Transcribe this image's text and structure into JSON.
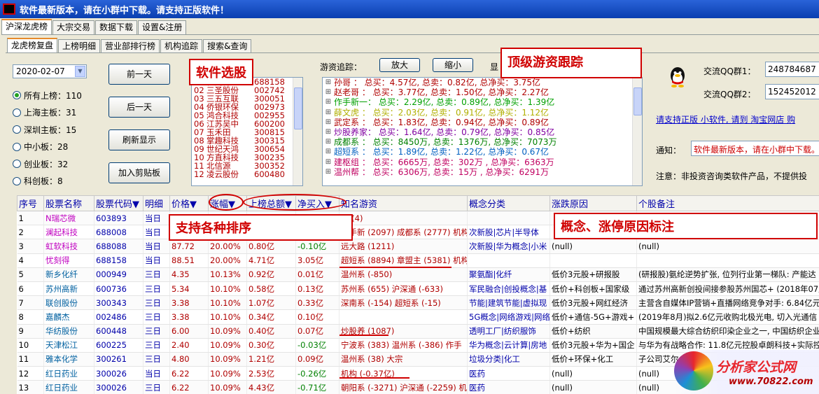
{
  "window": {
    "title": "软件最新版本，请在小群中下载。请支持正版软件！"
  },
  "top_tabs": [
    "沪深龙虎榜",
    "大宗交易",
    "数据下载",
    "设置&注册"
  ],
  "sub_tabs": [
    "龙虎榜复盘",
    "上榜明细",
    "营业部排行榜",
    "机构追踪",
    "搜索&查询"
  ],
  "controls": {
    "date": "2020-02-07",
    "radios": [
      "所有上榜：110",
      "上海主板：31",
      "深圳主板：15",
      "中小板：28",
      "创业板：32",
      "科创板：8"
    ],
    "selected_radio": 0,
    "buttons": [
      "前一天",
      "后一天",
      "刷新显示",
      "加入剪贴板"
    ]
  },
  "stock_picker": {
    "items": [
      {
        "no": "01",
        "name": "忧刻得",
        "code": "688158"
      },
      {
        "no": "02",
        "name": "三圣股份",
        "code": "002742"
      },
      {
        "no": "03",
        "name": "三五互联",
        "code": "300051"
      },
      {
        "no": "04",
        "name": "侨银环保",
        "code": "002973"
      },
      {
        "no": "05",
        "name": "鸿合科技",
        "code": "002955"
      },
      {
        "no": "06",
        "name": "江苏吴中",
        "code": "600200"
      },
      {
        "no": "07",
        "name": "玉禾田",
        "code": "300815"
      },
      {
        "no": "08",
        "name": "掌趣科技",
        "code": "300315"
      },
      {
        "no": "09",
        "name": "世纪天鸿",
        "code": "300654"
      },
      {
        "no": "10",
        "name": "方直科技",
        "code": "300235"
      },
      {
        "no": "11",
        "name": "北信源",
        "code": "300352"
      },
      {
        "no": "12",
        "name": "凌云股份",
        "code": "600480"
      }
    ]
  },
  "track": {
    "label": "游资追踪：",
    "zoom_in": "放大",
    "zoom_out": "缩小",
    "display_label": "显",
    "rows": [
      {
        "text": "孙哥    ： 总买：4.57亿, 总卖：0.82亿, 总净买：3.75亿",
        "color": "#b00000"
      },
      {
        "text": "赵老哥  ： 总买：3.77亿, 总卖：1.50亿, 总净买：2.27亿",
        "color": "#b00000"
      },
      {
        "text": "作手新一： 总买：2.29亿, 总卖：0.89亿, 总净买：1.39亿",
        "color": "#00a000"
      },
      {
        "text": "薛文虎  ： 总买：2.03亿, 总卖：0.91亿, 总净买：1.12亿",
        "color": "#b0b000"
      },
      {
        "text": "武定系  ： 总买：1.83亿, 总卖：0.94亿, 总净买：0.89亿",
        "color": "#b00000"
      },
      {
        "text": "炒股养家： 总买：1.64亿, 总卖：0.79亿, 总净买：0.85亿",
        "color": "#8000a0"
      },
      {
        "text": "成都系  ： 总买：8450万, 总卖：1376万, 总净买：7073万",
        "color": "#008000"
      },
      {
        "text": "超短系  ： 总买：1.89亿, 总卖：1.22亿, 总净买：0.67亿",
        "color": "#0060c0"
      },
      {
        "text": "建枢组  ： 总买：6665万, 总卖：302万 , 总净买：6363万",
        "color": "#c00060"
      },
      {
        "text": "温州帮  ： 总买：6306万, 总卖：15万  , 总净买：6291万",
        "color": "#c00060"
      }
    ]
  },
  "right_panel": {
    "qq1_label": "交流QQ群1：",
    "qq1": "248784687",
    "qq2_label": "交流QQ群2：",
    "qq2": "152452012",
    "link": "请支持正版 小软件, 请到 淘宝网店 购",
    "notice_label": "通知：",
    "notice": "软件最新版本，请在小群中下载。",
    "note": "注意：非投资咨询类软件产品，不提供投"
  },
  "callouts": {
    "picker": "软件选股",
    "track": "顶级游资跟踪",
    "sort": "支持各种排序",
    "concept": "概念、涨停原因标注"
  },
  "table": {
    "headers": [
      "序号",
      "股票名称",
      "股票代码▼",
      "明细",
      "价格▼",
      "涨幅▼",
      "上榜总额▼",
      "净买入▼",
      "知名游资",
      "概念分类",
      "涨跌原因",
      "个股备注"
    ],
    "rows": [
      [
        "1",
        "N瑞芯微",
        "603893",
        "当日",
        "",
        "",
        "",
        "",
        "海 (4)",
        "",
        "",
        ""
      ],
      [
        "2",
        "澜起科技",
        "688008",
        "当日",
        "",
        "",
        "",
        "",
        "通手新 (2097)  成都系 (2777)  机构",
        "次新股|芯片|半导体",
        "",
        ""
      ],
      [
        "3",
        "虹软科技",
        "688088",
        "当日",
        "87.72",
        "20.00%",
        "0.80亿",
        "-0.10亿",
        "远大路 (1211)",
        "次新股|华为概念|小米",
        "(null)",
        "(null)"
      ],
      [
        "4",
        "忧刻得",
        "688158",
        "当日",
        "88.51",
        "20.00%",
        "4.71亿",
        "3.05亿",
        "超短系 (8894)  章盟主 (5381)  机构",
        "",
        "",
        ""
      ],
      [
        "5",
        "新乡化纤",
        "000949",
        "三日",
        "4.35",
        "10.13%",
        "0.92亿",
        "0.01亿",
        "温州系 (-850)",
        "聚氨酯|化纤",
        "低价3元股+研报股",
        "(研报股)氨纶逆势扩张, 位列行业第一梯队: 产能达"
      ],
      [
        "6",
        "苏州高新",
        "600736",
        "三日",
        "5.34",
        "10.10%",
        "0.58亿",
        "0.13亿",
        "苏州系 (655)   沪深通 (-633)",
        "军民融合|创投概念|基",
        "低价+科创板+国家级",
        "通过苏州高新创投间接参股苏州国芯+ (2018年07月"
      ],
      [
        "7",
        "联创股份",
        "300343",
        "三日",
        "3.38",
        "10.10%",
        "1.07亿",
        "0.33亿",
        "深南系 (-154)  超短系 (-15)",
        "节能|建筑节能|虚拟现",
        "低价3元股+网红经济",
        "主营含自媒体IP营销+直播网络竞争对手: 6.84亿元"
      ],
      [
        "8",
        "嘉麟杰",
        "002486",
        "三日",
        "3.38",
        "10.10%",
        "0.34亿",
        "0.10亿",
        "",
        "5G概念|网络游戏|网络",
        "低价+通信-5G+游戏+",
        "(2019年8月)拟2.6亿元收购北极光电, 切入光通信"
      ],
      [
        "9",
        "华纺股份",
        "600448",
        "三日",
        "6.00",
        "10.09%",
        "0.40亿",
        "0.07亿",
        "炒股养 (1087)",
        "透明工厂|纺织服饰",
        "低价+纺织",
        "中国规模最大综合纺织印染企业之一, 中国纺织企业"
      ],
      [
        "10",
        "天津松江",
        "600225",
        "三日",
        "2.40",
        "10.09%",
        "0.30亿",
        "-0.03亿",
        "宁波系 (383)   温州系 (-386)  作手",
        "华为概念|云计算|房地",
        "低价3元股+华为+国企",
        "与华为有战略合作: 11.8亿元控股卓朗科技+实际控"
      ],
      [
        "11",
        "雅本化学",
        "300261",
        "三日",
        "4.80",
        "10.09%",
        "1.21亿",
        "0.09亿",
        "温州系 (38)    大宗",
        "垃圾分类|化工",
        "低价+环保+化工",
        "子公司艾尔..."
      ],
      [
        "12",
        "红日药业",
        "300026",
        "当日",
        "6.22",
        "10.09%",
        "2.53亿",
        "-0.26亿",
        "机构 (-0.37亿)",
        "医药",
        "(null)",
        "(null)"
      ],
      [
        "13",
        "红日药业",
        "300026",
        "三日",
        "6.22",
        "10.09%",
        "4.43亿",
        "-0.71亿",
        "朝阳系 (-3271) 沪深通 (-2259) 机构",
        "医药",
        "(null)",
        "(null)"
      ]
    ]
  },
  "watermark": {
    "title": "分析家公式网",
    "url": "www.70822.com"
  }
}
